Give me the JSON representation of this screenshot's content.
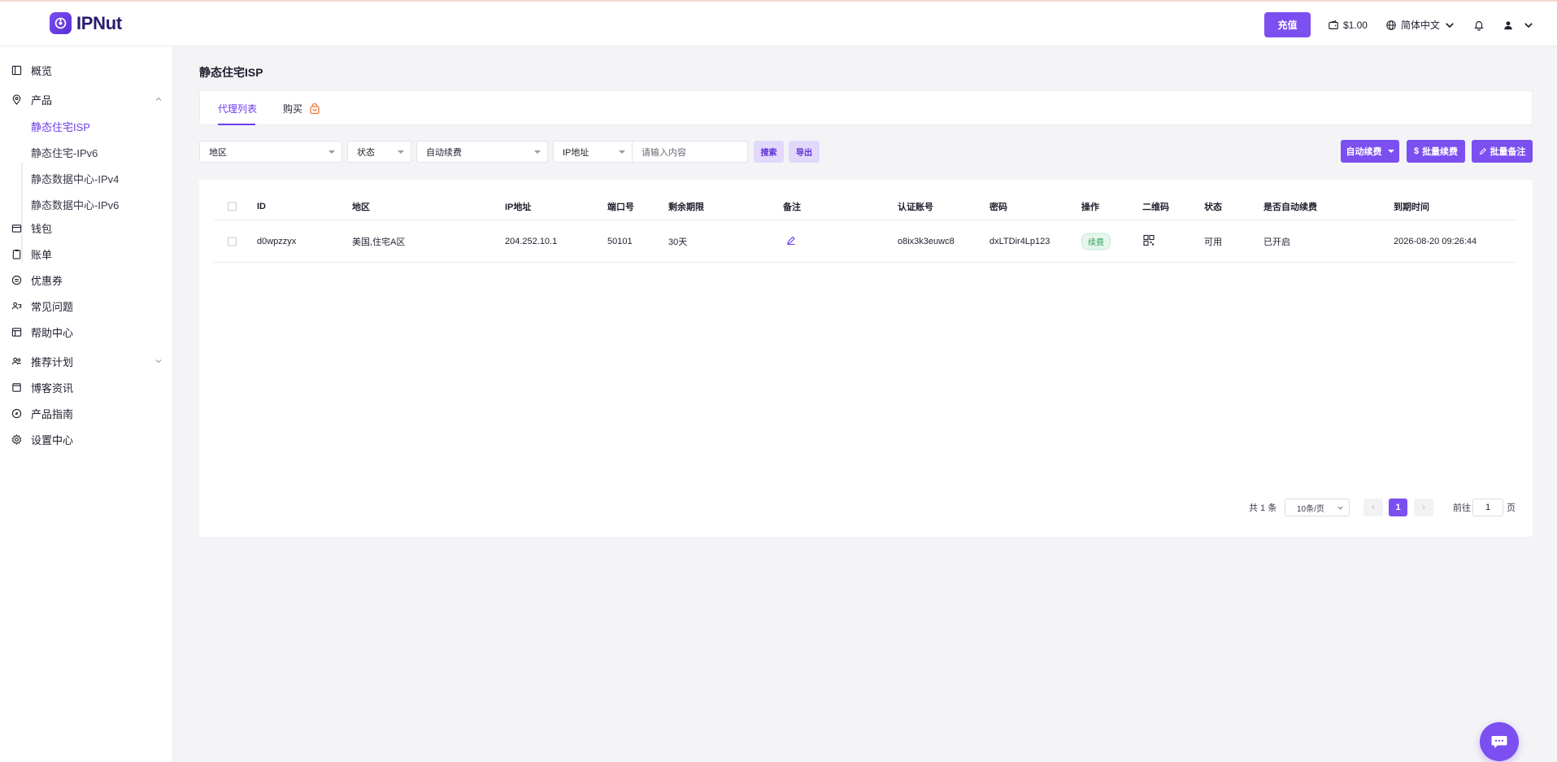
{
  "header": {
    "brand": "IPNut",
    "recharge_label": "充值",
    "balance": "$1.00",
    "language": "简体中文",
    "icons": [
      "wallet-icon",
      "globe-icon",
      "bell-icon",
      "user-icon"
    ]
  },
  "sidebar": {
    "items": [
      {
        "label": "概览",
        "icon": "overview-icon"
      },
      {
        "label": "产品",
        "icon": "location-pin-icon"
      },
      {
        "label": "钱包",
        "icon": "wallet-icon"
      },
      {
        "label": "账单",
        "icon": "clipboard-icon"
      },
      {
        "label": "优惠券",
        "icon": "coupon-icon"
      },
      {
        "label": "常见问题",
        "icon": "faq-icon"
      },
      {
        "label": "帮助中心",
        "icon": "help-icon"
      },
      {
        "label": "推荐计划",
        "icon": "referral-icon"
      },
      {
        "label": "博客资讯",
        "icon": "blog-icon"
      },
      {
        "label": "产品指南",
        "icon": "compass-icon"
      },
      {
        "label": "设置中心",
        "icon": "gear-icon"
      }
    ],
    "product_sub": [
      {
        "label": "静态住宅ISP",
        "active": true
      },
      {
        "label": "静态住宅-IPv6",
        "active": false
      },
      {
        "label": "静态数据中心-IPv4",
        "active": false
      },
      {
        "label": "静态数据中心-IPv6",
        "active": false
      }
    ]
  },
  "page": {
    "title": "静态住宅ISP",
    "tabs": [
      {
        "label": "代理列表",
        "active": true
      },
      {
        "label": "购买",
        "active": false
      }
    ]
  },
  "filters": {
    "region": "地区",
    "status": "状态",
    "auto_renew": "自动续费",
    "ip_type": "IP地址",
    "search_placeholder": "请输入内容",
    "search_label": "搜索",
    "export_label": "导出"
  },
  "actions": {
    "auto_renew": "自动续费",
    "batch_renew": "批量续费",
    "batch_note": "批量备注"
  },
  "table": {
    "headers": [
      "ID",
      "地区",
      "IP地址",
      "端口号",
      "剩余期限",
      "备注",
      "认证账号",
      "密码",
      "操作",
      "二维码",
      "状态",
      "是否自动续费",
      "到期时间"
    ],
    "rows": [
      {
        "id": "d0wpzzyx",
        "region": "美国,住宅A区",
        "ip": "204.252.10.1",
        "port": "50101",
        "remaining": "30天",
        "account": "o8ix3k3euwc8",
        "password": "dxLTDir4Lp123",
        "action": "续费",
        "status": "可用",
        "auto_renew": "已开启",
        "expire": "2026-08-20 09:26:44"
      }
    ]
  },
  "pagination": {
    "total": "共 1 条",
    "page_size": "10条/页",
    "current_page": "1",
    "goto_label": "前往",
    "goto_value": "1",
    "page_unit": "页"
  },
  "colors": {
    "accent": "#7b4ff0",
    "accent_light": "#e2d8fb",
    "success": "#2f9e5a"
  }
}
